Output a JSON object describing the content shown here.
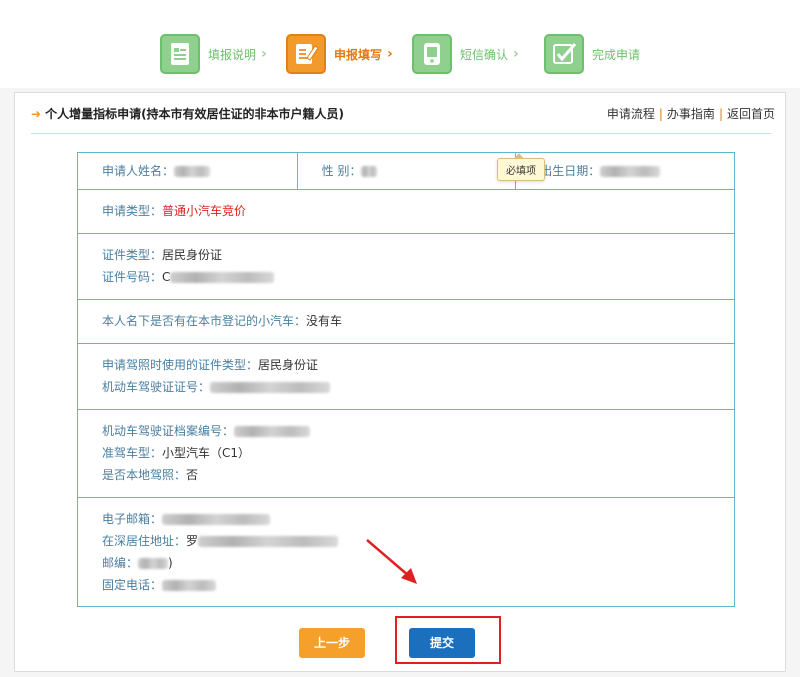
{
  "steps": [
    {
      "label": "填报说明",
      "icon": "document-icon",
      "active": false
    },
    {
      "label": "申报填写",
      "icon": "pencil-form-icon",
      "active": true
    },
    {
      "label": "短信确认",
      "icon": "phone-icon",
      "active": false
    },
    {
      "label": "完成申请",
      "icon": "checkmark-icon",
      "active": false
    }
  ],
  "step_arrow": "›",
  "panel": {
    "title": "个人增量指标申请(持本市有效居住证的非本市户籍人员)",
    "links": [
      "申请流程",
      "办事指南",
      "返回首页"
    ],
    "link_separator": "|"
  },
  "form": {
    "name_label": "申请人姓名：",
    "gender_label": "性 别：",
    "birth_label": "出生日期：",
    "apply_type_label": "申请类型：",
    "apply_type_value": "普通小汽车竞价",
    "required_tip": "必填项",
    "id_type_label": "证件类型：",
    "id_type_value": "居民身份证",
    "id_number_label": "证件号码：",
    "id_number_prefix": "C",
    "car_question_label": "本人名下是否有在本市登记的小汽车：",
    "car_question_value": "没有车",
    "license_id_type_label": "申请驾照时使用的证件类型：",
    "license_id_type_value": "居民身份证",
    "license_number_label": "机动车驾驶证证号：",
    "license_file_label": "机动车驾驶证档案编号：",
    "vehicle_class_label": "准驾车型：",
    "vehicle_class_value": "小型汽车（C1）",
    "local_license_label": "是否本地驾照：",
    "local_license_value": "否",
    "email_label": "电子邮箱：",
    "address_label": "在深居住地址：",
    "address_prefix": "罗",
    "postcode_label": "邮编：",
    "postcode_suffix": ")",
    "phone_label": "固定电话："
  },
  "buttons": {
    "prev": "上一步",
    "submit": "提交"
  },
  "colors": {
    "accent_orange": "#f29a2b",
    "submit_blue": "#1b6fbd",
    "highlight_red": "#e02020",
    "border_teal": "#5fb7c9"
  }
}
